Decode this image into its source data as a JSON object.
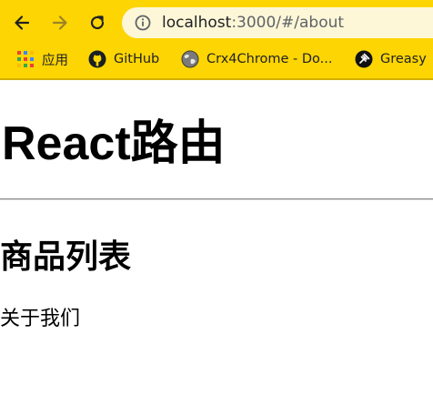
{
  "browser": {
    "url_host": "localhost",
    "url_rest": ":3000/#/about",
    "accent_color": "#fdd503",
    "bookmarks": [
      {
        "label": "应用",
        "icon": "apps-grid-icon"
      },
      {
        "label": "GitHub",
        "icon": "github-icon"
      },
      {
        "label": "Crx4Chrome - Do...",
        "icon": "globe-icon"
      },
      {
        "label": "Greasy",
        "icon": "greasy-fork-icon"
      }
    ]
  },
  "page": {
    "title": "React路由",
    "subtitle": "商品列表",
    "text": "关于我们"
  }
}
